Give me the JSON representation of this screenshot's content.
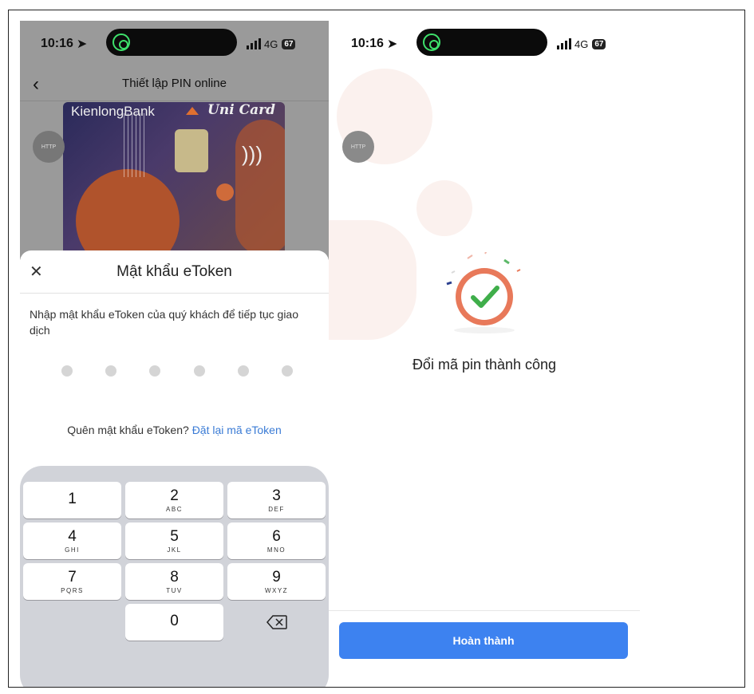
{
  "left": {
    "status": {
      "time": "10:16",
      "network": "4G",
      "battery": "67"
    },
    "nav": {
      "title": "Thiết lập PIN online"
    },
    "card": {
      "bank": "KienlongBank",
      "product": "Uni Card",
      "http_badge": "HTTP"
    },
    "sheet": {
      "title": "Mật khẩu eToken",
      "description": "Nhập mật khẩu eToken của quý khách để tiếp tục giao dịch",
      "pin_length": 6,
      "forgot_text": "Quên mật khẩu eToken?",
      "reset_link": "Đặt lại mã eToken"
    },
    "keypad": {
      "keys": [
        {
          "num": "1",
          "letters": ""
        },
        {
          "num": "2",
          "letters": "ABC"
        },
        {
          "num": "3",
          "letters": "DEF"
        },
        {
          "num": "4",
          "letters": "GHI"
        },
        {
          "num": "5",
          "letters": "JKL"
        },
        {
          "num": "6",
          "letters": "MNO"
        },
        {
          "num": "7",
          "letters": "PQRS"
        },
        {
          "num": "8",
          "letters": "TUV"
        },
        {
          "num": "9",
          "letters": "WXYZ"
        },
        {
          "num": "0",
          "letters": ""
        }
      ]
    }
  },
  "right": {
    "status": {
      "time": "10:16",
      "network": "4G",
      "battery": "67"
    },
    "http_badge": "HTTP",
    "message": "Đổi mã pin thành công",
    "button": "Hoàn thành",
    "colors": {
      "accent": "#3d82f0",
      "check": "#3fae4a",
      "ring": "#e8795a"
    }
  }
}
